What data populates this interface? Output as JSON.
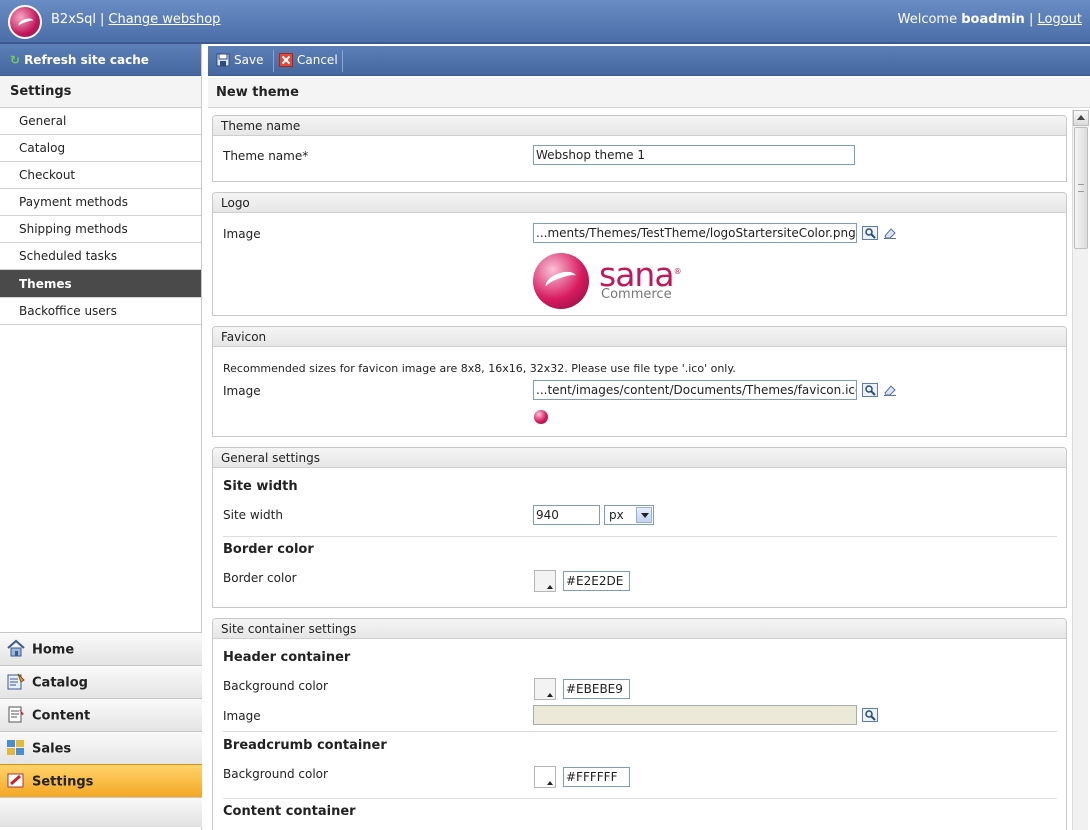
{
  "header": {
    "app_name": "B2xSql",
    "separator": "|",
    "change_webshop": "Change webshop",
    "welcome": "Welcome",
    "username": "boadmin",
    "logout": "Logout"
  },
  "sidebar": {
    "refresh_label": "Refresh site cache",
    "settings_title": "Settings",
    "items": [
      {
        "label": "General"
      },
      {
        "label": "Catalog"
      },
      {
        "label": "Checkout"
      },
      {
        "label": "Payment methods"
      },
      {
        "label": "Shipping methods"
      },
      {
        "label": "Scheduled tasks"
      },
      {
        "label": "Themes",
        "active": true
      },
      {
        "label": "Backoffice users"
      }
    ],
    "bottom_nav": [
      {
        "label": "Home",
        "icon": "home-icon"
      },
      {
        "label": "Catalog",
        "icon": "catalog-icon"
      },
      {
        "label": "Content",
        "icon": "content-icon"
      },
      {
        "label": "Sales",
        "icon": "sales-icon"
      },
      {
        "label": "Settings",
        "icon": "settings-icon",
        "active": true
      }
    ]
  },
  "toolbar": {
    "save_label": "Save",
    "cancel_label": "Cancel"
  },
  "page": {
    "title": "New theme"
  },
  "sections": {
    "theme_name": {
      "title": "Theme name",
      "label": "Theme name*",
      "value": "Webshop theme 1"
    },
    "logo": {
      "title": "Logo",
      "image_label": "Image",
      "image_value": "...ments/Themes/TestTheme/logoStartersiteColor.png",
      "logo_word": "sana",
      "logo_reg": "®",
      "logo_sub": "Commerce"
    },
    "favicon": {
      "title": "Favicon",
      "note": "Recommended sizes for favicon image are 8x8, 16x16, 32x32. Please use file type '.ico' only.",
      "image_label": "Image",
      "image_value": "...tent/images/content/Documents/Themes/favicon.ico"
    },
    "general_settings": {
      "title": "General settings",
      "site_width_heading": "Site width",
      "site_width_label": "Site width",
      "site_width_value": "940",
      "site_width_unit": "px",
      "border_color_heading": "Border color",
      "border_color_label": "Border color",
      "border_color_value": "#E2E2DE"
    },
    "site_container": {
      "title": "Site container settings",
      "header_heading": "Header container",
      "header_bg_label": "Background color",
      "header_bg_value": "#EBEBE9",
      "header_image_label": "Image",
      "header_image_value": "",
      "breadcrumb_heading": "Breadcrumb container",
      "breadcrumb_bg_label": "Background color",
      "breadcrumb_bg_value": "#FFFFFF",
      "content_heading": "Content container"
    }
  },
  "colors": {
    "header_blue": "#4c6ea8",
    "active_nav": "#4a4a4a",
    "settings_active": "#f3a724",
    "brand": "#c2185b"
  }
}
